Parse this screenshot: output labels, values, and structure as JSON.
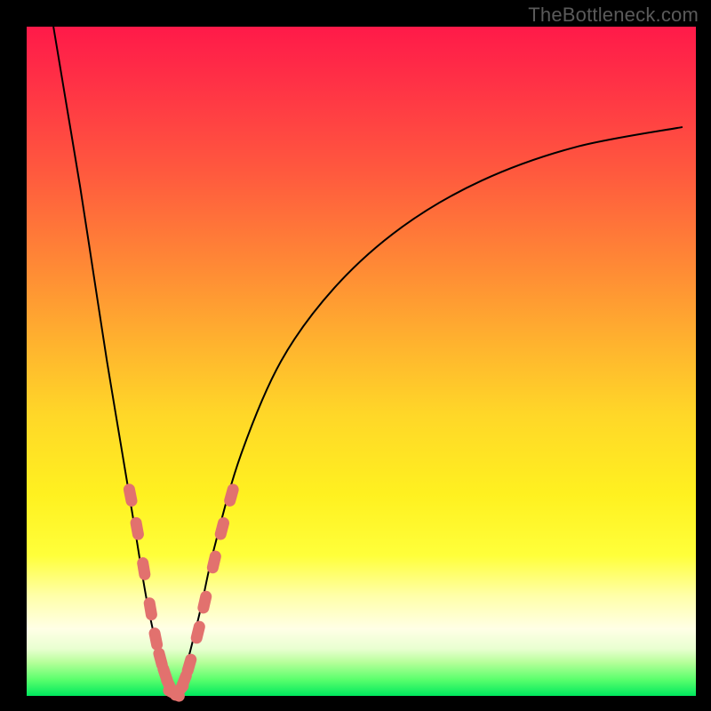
{
  "watermark": "TheBottleneck.com",
  "colors": {
    "frame": "#000000",
    "marker": "#e2716e",
    "curve": "#000000"
  },
  "chart_data": {
    "type": "line",
    "title": "",
    "xlabel": "",
    "ylabel": "",
    "xlim": [
      0,
      100
    ],
    "ylim": [
      0,
      100
    ],
    "series": [
      {
        "name": "bottleneck-curve",
        "note": "V-shaped curve; minimum (~0) near x≈22; rises steeply toward 100 at the left edge and asymptotically toward ~85 on the right.",
        "x": [
          4,
          6,
          8,
          10,
          12,
          14,
          16,
          18,
          20,
          21,
          22,
          23,
          24,
          26,
          28,
          32,
          38,
          46,
          56,
          68,
          82,
          98
        ],
        "y": [
          100,
          88,
          76,
          63,
          50,
          38,
          26,
          14,
          5,
          1.5,
          0,
          1.5,
          5,
          13,
          22,
          36,
          50,
          61,
          70,
          77,
          82,
          85
        ]
      }
    ],
    "markers": {
      "name": "highlighted-points",
      "note": "Salmon capsule markers clustered on both arms near the trough (approximate readings).",
      "points": [
        {
          "x": 15.5,
          "y": 30
        },
        {
          "x": 16.5,
          "y": 25
        },
        {
          "x": 17.5,
          "y": 19
        },
        {
          "x": 18.5,
          "y": 13
        },
        {
          "x": 19.3,
          "y": 8.5
        },
        {
          "x": 20.0,
          "y": 5.5
        },
        {
          "x": 20.7,
          "y": 3.2
        },
        {
          "x": 21.3,
          "y": 1.6
        },
        {
          "x": 22.0,
          "y": 0.4
        },
        {
          "x": 22.8,
          "y": 0.8
        },
        {
          "x": 23.5,
          "y": 2.2
        },
        {
          "x": 24.3,
          "y": 4.6
        },
        {
          "x": 25.6,
          "y": 9.5
        },
        {
          "x": 26.6,
          "y": 14
        },
        {
          "x": 28.0,
          "y": 20
        },
        {
          "x": 29.2,
          "y": 25
        },
        {
          "x": 30.6,
          "y": 30
        }
      ]
    }
  }
}
